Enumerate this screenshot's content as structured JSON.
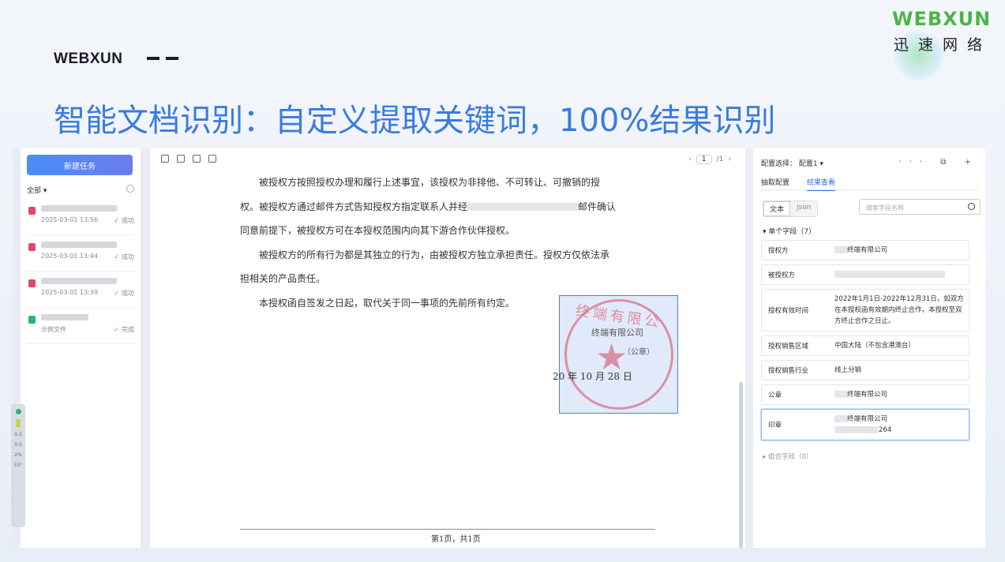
{
  "brand": {
    "left_text": "WEBXUN",
    "logo_en": "WEBXUN",
    "logo_cn": "迅速网络"
  },
  "headline": "智能文档识别：自定义提取关键词，100%结果识别",
  "left_panel": {
    "new_task": "新建任务",
    "filter": "全部 ▾",
    "tasks": [
      {
        "date": "2025-03-01 13:56",
        "status": "成功"
      },
      {
        "date": "2025-03-01 13:44",
        "status": "成功"
      },
      {
        "date": "2025-03-01 13:39",
        "status": "成功"
      },
      {
        "date": "示例文件",
        "status": "完成"
      }
    ]
  },
  "doc": {
    "pager": {
      "prev": "‹",
      "current": "1",
      "total": "/1",
      "next": "›"
    },
    "lines": [
      {
        "indent": true,
        "text": "被授权方按照授权办理和履行上述事宜，该授权为非排他、不可转让、可撤销的授"
      },
      {
        "indent": false,
        "a": "权。被授权方通过邮件方式告知授权方指定联系人并经",
        "b": "邮件确认"
      },
      {
        "indent": false,
        "text": "同意前提下，被授权方可在本授权范围内向其下游合作伙伴授权。"
      },
      {
        "indent": true,
        "text": "被授权方的所有行为都是其独立的行为，由被授权方独立承担责任。授权方仅依法承"
      },
      {
        "indent": false,
        "text": "担相关的产品责任。"
      },
      {
        "indent": true,
        "text": "本授权函自签发之日起，取代关于同一事项的先前所有约定。"
      }
    ],
    "seal_arc": "终端有限公",
    "seal_company": "终端有限公司",
    "seal_sub": "（公章）",
    "date_text": "20   年 10 月 28 日",
    "footer": "第1页，共1页"
  },
  "right_panel": {
    "config_label": "配置选择：",
    "config_value": "配置1 ▾",
    "icons": "··· ⧉ +",
    "tabs": [
      "抽取配置",
      "结果查看"
    ],
    "seg": [
      "文本",
      "json"
    ],
    "search_placeholder": "搜索字段名称",
    "section": "▾  单个字段（7）",
    "fields": [
      {
        "label": "授权方",
        "value": "终端有限公司"
      },
      {
        "label": "被授权方",
        "value": ""
      },
      {
        "label": "授权有效时间",
        "value": "2022年1月1日-2022年12月31日，如双方在本授权函有效期内终止合作，本授权至双方终止合作之日止。"
      },
      {
        "label": "授权销售区域",
        "value": "中国大陆（不包含港澳台）"
      },
      {
        "label": "授权销售行业",
        "value": "线上分销"
      },
      {
        "label": "公章",
        "value": "终端有限公司"
      },
      {
        "label": "印章",
        "value": "终端有限公司",
        "value2": "264"
      }
    ],
    "combo": "▸  组合字段（0）"
  },
  "side_widget": {
    "values": [
      "0.2",
      "0.0",
      "2%",
      "53°"
    ]
  }
}
